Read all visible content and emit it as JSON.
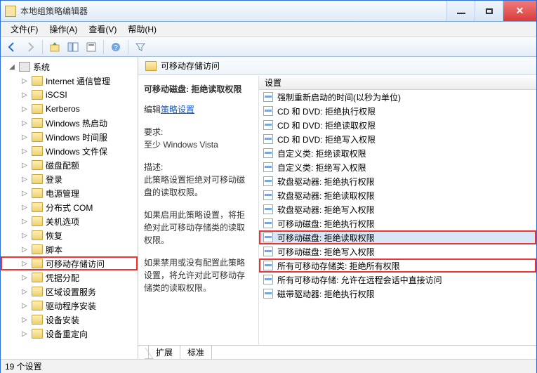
{
  "window": {
    "title": "本地组策略编辑器"
  },
  "menu": {
    "file": "文件(F)",
    "action": "操作(A)",
    "view": "查看(V)",
    "help": "帮助(H)"
  },
  "tree": {
    "root": "系统",
    "items": [
      "Internet 通信管理",
      "iSCSI",
      "Kerberos",
      "Windows 热启动",
      "Windows 时间服",
      "Windows 文件保",
      "磁盘配额",
      "登录",
      "电源管理",
      "分布式 COM",
      "关机选项",
      "恢复",
      "脚本",
      "可移动存储访问",
      "凭据分配",
      "区域设置服务",
      "驱动程序安装",
      "设备安装",
      "设备重定向"
    ],
    "selected_index": 13
  },
  "panel": {
    "folder_title": "可移动存储访问",
    "headline": "可移动磁盘: 拒绝读取权限",
    "edit_label": "编辑",
    "edit_link": "策略设置",
    "req_label": "要求:",
    "req_text": "至少 Windows Vista",
    "desc_label": "描述:",
    "desc_text": "此策略设置拒绝对可移动磁盘的读取权限。",
    "enable_text": "如果启用此策略设置，将拒绝对此可移动存储类的读取权限。",
    "disable_text": "如果禁用或没有配置此策略设置，将允许对此可移动存储类的读取权限。"
  },
  "settings": {
    "header": "设置",
    "items": [
      "强制重新启动的时间(以秒为单位)",
      "CD 和 DVD: 拒绝执行权限",
      "CD 和 DVD: 拒绝读取权限",
      "CD 和 DVD: 拒绝写入权限",
      "自定义类: 拒绝读取权限",
      "自定义类: 拒绝写入权限",
      "软盘驱动器: 拒绝执行权限",
      "软盘驱动器: 拒绝读取权限",
      "软盘驱动器: 拒绝写入权限",
      "可移动磁盘: 拒绝执行权限",
      "可移动磁盘: 拒绝读取权限",
      "可移动磁盘: 拒绝写入权限",
      "所有可移动存储类: 拒绝所有权限",
      "所有可移动存储: 允许在远程会话中直接访问",
      "磁带驱动器: 拒绝执行权限"
    ],
    "highlights": [
      10,
      12
    ],
    "selected": 10
  },
  "tabs": {
    "ext": "扩展",
    "std": "标准"
  },
  "status": "19 个设置"
}
